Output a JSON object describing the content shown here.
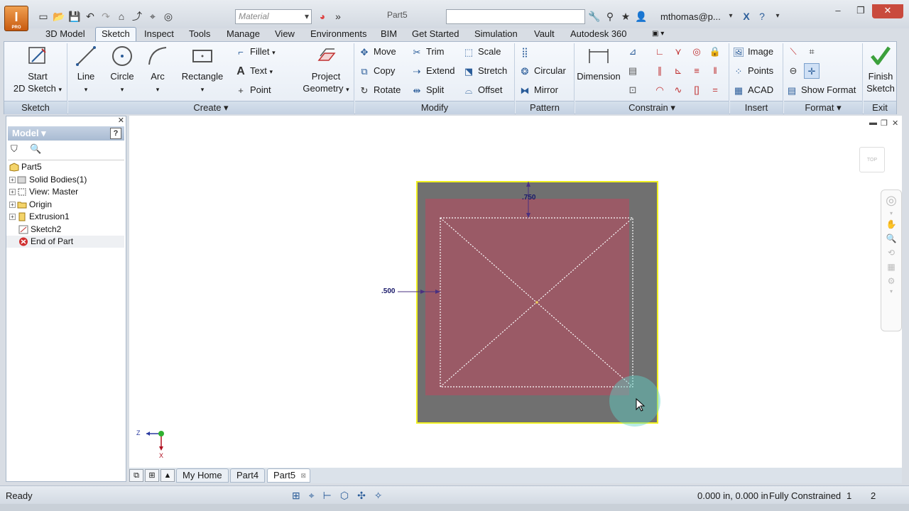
{
  "window": {
    "app_badge": "PRO",
    "material_placeholder": "Material",
    "document_title": "Part5",
    "user": "mthomas@p...",
    "controls": [
      "–",
      "❐",
      "✕"
    ]
  },
  "tabs": [
    {
      "label": "3D Model",
      "active": false
    },
    {
      "label": "Sketch",
      "active": true
    },
    {
      "label": "Inspect",
      "active": false
    },
    {
      "label": "Tools",
      "active": false
    },
    {
      "label": "Manage",
      "active": false
    },
    {
      "label": "View",
      "active": false
    },
    {
      "label": "Environments",
      "active": false
    },
    {
      "label": "BIM",
      "active": false
    },
    {
      "label": "Get Started",
      "active": false
    },
    {
      "label": "Simulation",
      "active": false
    },
    {
      "label": "Vault",
      "active": false
    },
    {
      "label": "Autodesk 360",
      "active": false
    }
  ],
  "ribbon": {
    "sketch": {
      "panel": "Sketch",
      "start_line1": "Start",
      "start_line2": "2D Sketch"
    },
    "create": {
      "panel": "Create ▾",
      "line": "Line",
      "circle": "Circle",
      "arc": "Arc",
      "rectangle": "Rectangle",
      "fillet": "Fillet",
      "text": "Text",
      "point": "Point",
      "project_line1": "Project",
      "project_line2": "Geometry"
    },
    "modify": {
      "panel": "Modify",
      "move": "Move",
      "copy": "Copy",
      "rotate": "Rotate",
      "trim": "Trim",
      "extend": "Extend",
      "split": "Split",
      "scale": "Scale",
      "stretch": "Stretch",
      "offset": "Offset"
    },
    "pattern": {
      "panel": "Pattern",
      "circular": "Circular",
      "mirror": "Mirror"
    },
    "constrain": {
      "panel": "Constrain ▾",
      "dimension": "Dimension"
    },
    "insert": {
      "panel": "Insert",
      "image": "Image",
      "points": "Points",
      "acad": "ACAD"
    },
    "format": {
      "panel": "Format ▾",
      "show_format": "Show Format"
    },
    "exit": {
      "panel": "Exit",
      "finish_line1": "Finish",
      "finish_line2": "Sketch"
    }
  },
  "browser": {
    "title": "Model ▾",
    "tree": [
      {
        "label": "Part5",
        "level": 0
      },
      {
        "label": "Solid Bodies(1)",
        "level": 1
      },
      {
        "label": "View: Master",
        "level": 1
      },
      {
        "label": "Origin",
        "level": 1
      },
      {
        "label": "Extrusion1",
        "level": 1
      },
      {
        "label": "Sketch2",
        "level": 1
      },
      {
        "label": "End of Part",
        "level": 1
      }
    ]
  },
  "canvas": {
    "dim_vertical": ".750",
    "dim_horizontal": ".500",
    "axis_z": "Z",
    "axis_x": "X",
    "viewcube_label": "TOP"
  },
  "doc_tabs": [
    "My Home",
    "Part4",
    "Part5"
  ],
  "status": {
    "left": "Ready",
    "coords": "0.000 in, 0.000 in",
    "state": "Fully Constrained",
    "n1": "1",
    "n2": "2"
  },
  "colors": {
    "sketch_fill": "#9a5a66",
    "part_face": "#707070",
    "highlight": "#f0f020",
    "accent": "#2a5c99"
  }
}
